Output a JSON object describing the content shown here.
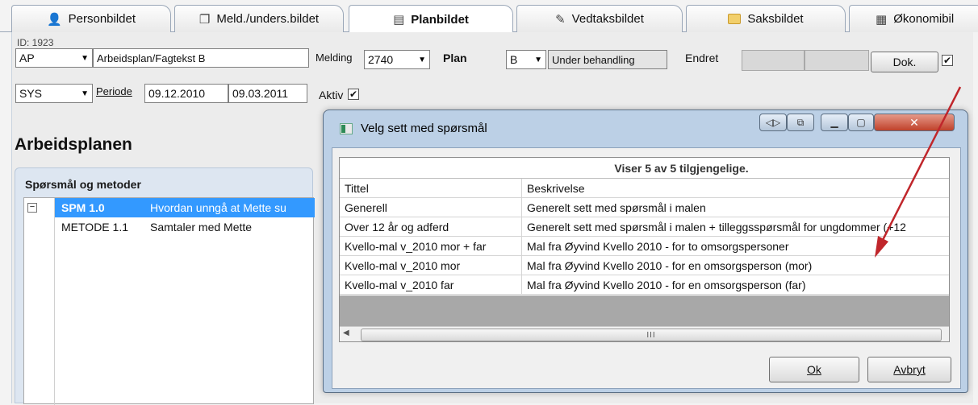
{
  "tabs": [
    {
      "label": "Personbildet",
      "icon": "person-icon"
    },
    {
      "label": "Meld./unders.bildet",
      "icon": "documents-icon"
    },
    {
      "label": "Planbildet",
      "icon": "calendar-icon"
    },
    {
      "label": "Vedtaksbildet",
      "icon": "pen-icon"
    },
    {
      "label": "Saksbildet",
      "icon": "folder-icon"
    },
    {
      "label": "Økonomibil",
      "icon": "calculator-icon"
    }
  ],
  "form": {
    "id_label": "ID: 1923",
    "type_code": "AP",
    "type_text": "Arbeidsplan/Fagtekst B",
    "melding_label": "Melding",
    "melding_value": "2740",
    "plan_label": "Plan",
    "plan_value": "B",
    "plan_status": "Under behandling",
    "endret_label": "Endret",
    "dok_label": "Dok.",
    "dok_checked": "✔",
    "user_code": "SYS",
    "periode_label": "Periode",
    "periode_from": "09.12.2010",
    "periode_to": "09.03.2011",
    "aktiv_label": "Aktiv",
    "aktiv_checked": "✔"
  },
  "arbeidsplanen": {
    "heading": "Arbeidsplanen",
    "panel_title": "Spørsmål og metoder",
    "rows": [
      {
        "expander": "−",
        "code": "SPM 1.0",
        "text": "Hvordan unngå at Mette su"
      },
      {
        "expander": "",
        "code": "METODE 1.1",
        "text": "Samtaler med Mette"
      }
    ]
  },
  "dialog": {
    "title": "Velg sett med spørsmål",
    "caption": "Viser 5 av 5 tilgjengelige.",
    "columns": [
      "Tittel",
      "Beskrivelse"
    ],
    "rows": [
      {
        "title": "Generell",
        "description": "Generelt sett med spørsmål i malen"
      },
      {
        "title": "Over 12 år og adferd",
        "description": "Generelt sett med spørsmål i malen + tilleggsspørsmål for ungdommer (+12"
      },
      {
        "title": "Kvello-mal v_2010 mor + far",
        "description": "Mal fra Øyvind Kvello 2010 - for to omsorgspersoner"
      },
      {
        "title": "Kvello-mal v_2010 mor",
        "description": "Mal fra Øyvind Kvello 2010 - for en omsorgsperson (mor)"
      },
      {
        "title": "Kvello-mal v_2010 far",
        "description": "Mal fra Øyvind Kvello 2010 - for en omsorgsperson (far)"
      }
    ],
    "scroll_grip": "III",
    "ok_label": "Ok",
    "cancel_label": "Avbryt"
  }
}
